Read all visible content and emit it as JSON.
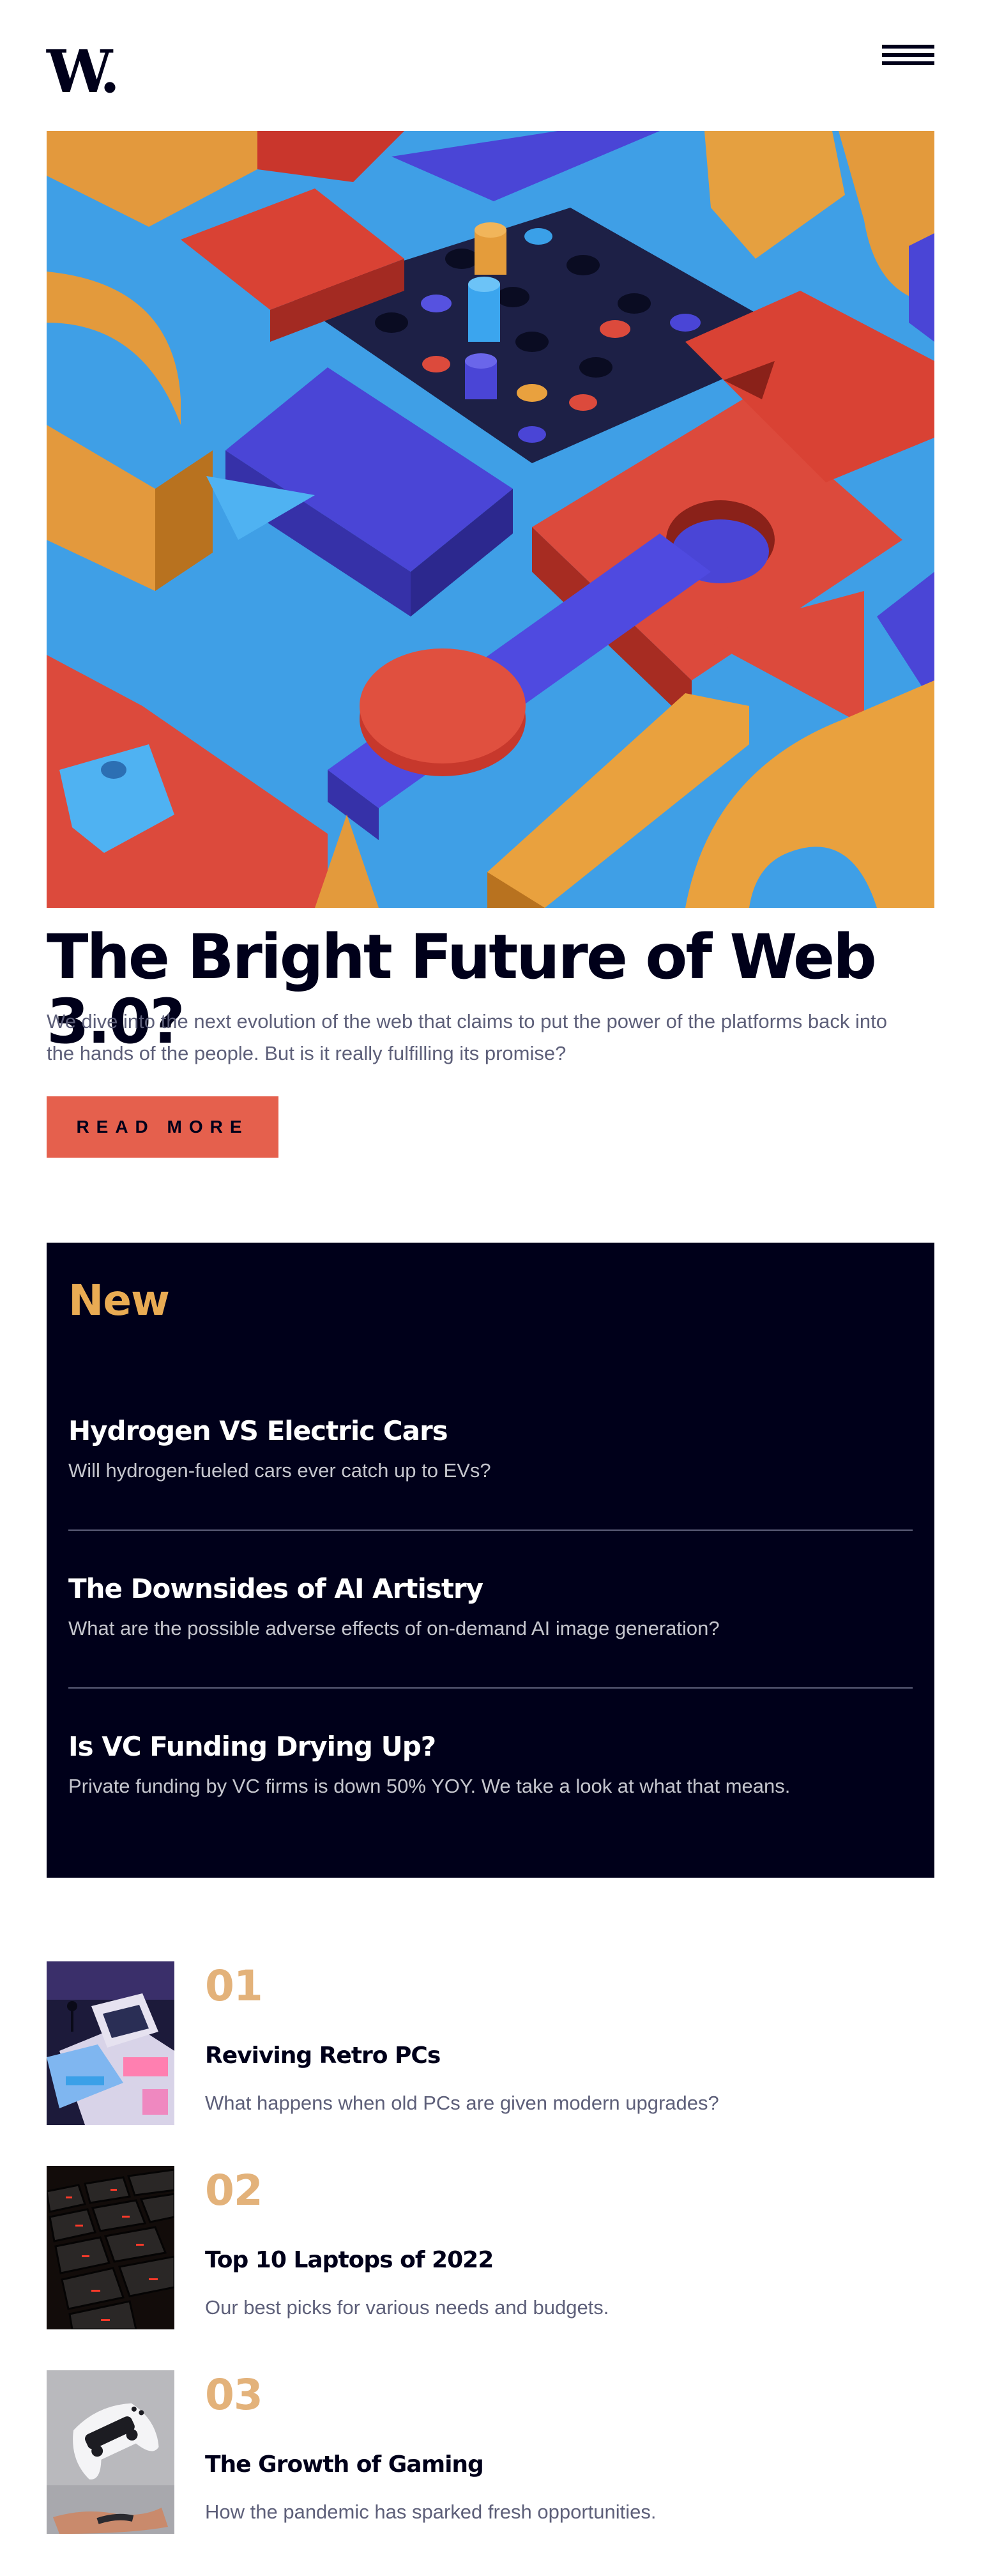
{
  "header": {
    "logo_text": "W.",
    "menu_icon": "hamburger-menu-icon"
  },
  "hero": {
    "title": "The Bright Future of Web 3.0?",
    "description": "We dive into the next evolution of the web that claims to put the power of the platforms back into the hands of the people. But is it really fulfilling its promise?",
    "button_label": "READ MORE"
  },
  "new_section": {
    "heading": "New",
    "items": [
      {
        "title": "Hydrogen VS Electric Cars",
        "description": "Will hydrogen-fueled cars ever catch up to EVs?"
      },
      {
        "title": "The Downsides of AI Artistry",
        "description": "What are the possible adverse effects of on-demand AI image generation?"
      },
      {
        "title": "Is VC Funding Drying Up?",
        "description": "Private funding by VC firms is down 50% YOY. We take a look at what that means."
      }
    ]
  },
  "numbered_list": [
    {
      "number": "01",
      "title": "Reviving Retro PCs",
      "description": "What happens when old PCs are given modern upgrades?"
    },
    {
      "number": "02",
      "title": "Top 10 Laptops of 2022",
      "description": "Our best picks for various needs and budgets."
    },
    {
      "number": "03",
      "title": "The Growth of Gaming",
      "description": "How the pandemic has sparked fresh opportunities."
    }
  ],
  "colors": {
    "dark_navy": "#00001a",
    "soft_red": "#e5604d",
    "soft_orange": "#e9ab53",
    "grayish_blue": "#5d5f79",
    "off_white": "#fffdfa"
  }
}
